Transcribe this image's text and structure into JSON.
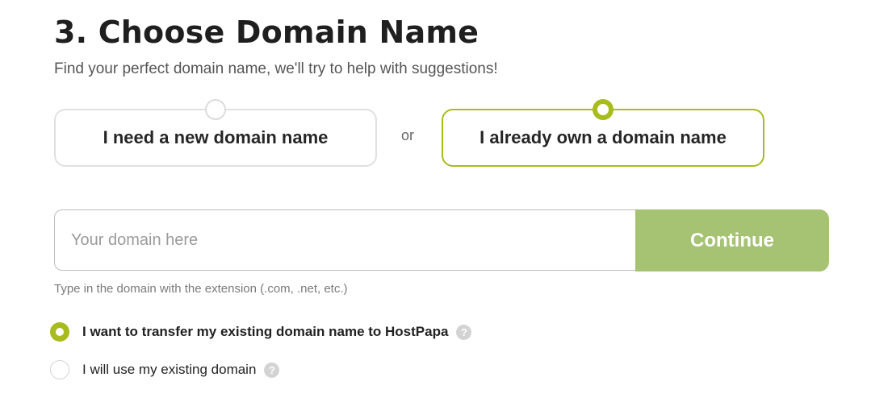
{
  "section": {
    "title": "3. Choose Domain Name",
    "subtitle": "Find your perfect domain name, we'll try to help with suggestions!"
  },
  "options": {
    "new_domain": {
      "label": "I need a new domain name",
      "selected": false
    },
    "separator": "or",
    "own_domain": {
      "label": "I already own a domain name",
      "selected": true
    }
  },
  "domain_form": {
    "input_value": "",
    "input_placeholder": "Your domain here",
    "continue_label": "Continue",
    "hint": "Type in the domain with the extension (.com, .net, etc.)"
  },
  "ownership_choices": [
    {
      "label": "I want to transfer my existing domain name to HostPapa",
      "selected": true,
      "help_icon": "?"
    },
    {
      "label": "I will use my existing domain",
      "selected": false,
      "help_icon": "?"
    }
  ],
  "colors": {
    "accent": "#a8bd1d",
    "continue_button": "#a6c273",
    "card_border": "#e0e0e3",
    "help_icon": "#d3d3d3"
  }
}
